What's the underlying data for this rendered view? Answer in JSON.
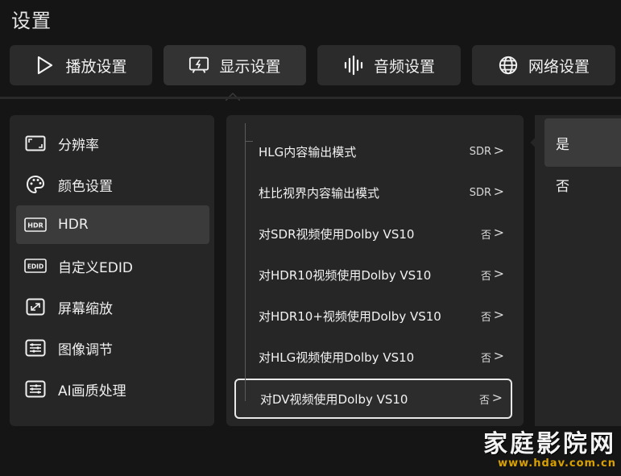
{
  "page": {
    "title": "设置"
  },
  "tabs": [
    {
      "label": "播放设置",
      "icon": "play-icon",
      "active": false
    },
    {
      "label": "显示设置",
      "icon": "display-icon",
      "active": true
    },
    {
      "label": "音频设置",
      "icon": "audio-wave-icon",
      "active": false
    },
    {
      "label": "网络设置",
      "icon": "globe-icon",
      "active": false
    }
  ],
  "sidebar": {
    "items": [
      {
        "label": "分辨率",
        "icon": "resolution-icon"
      },
      {
        "label": "颜色设置",
        "icon": "palette-icon"
      },
      {
        "label": "HDR",
        "icon": "hdr-icon",
        "badge": "HDR",
        "active": true
      },
      {
        "label": "自定义EDID",
        "icon": "edid-icon",
        "badge": "EDID"
      },
      {
        "label": "屏幕缩放",
        "icon": "expand-icon"
      },
      {
        "label": "图像调节",
        "icon": "sliders-icon"
      },
      {
        "label": "AI画质处理",
        "icon": "ai-sliders-icon"
      }
    ]
  },
  "options": {
    "items": [
      {
        "label": "HLG内容输出模式",
        "value": "SDR"
      },
      {
        "label": "杜比视界内容输出模式",
        "value": "SDR"
      },
      {
        "label": "对SDR视频使用Dolby VS10",
        "value": "否"
      },
      {
        "label": "对HDR10视频使用Dolby VS10",
        "value": "否"
      },
      {
        "label": "对HDR10+视频使用Dolby VS10",
        "value": "否"
      },
      {
        "label": "对HLG视频使用Dolby VS10",
        "value": "否"
      },
      {
        "label": "对DV视频使用Dolby VS10",
        "value": "否",
        "focused": true
      }
    ],
    "chevron": ">"
  },
  "choices": {
    "items": [
      {
        "label": "是",
        "active": true
      },
      {
        "label": "否",
        "active": false
      }
    ]
  },
  "watermark": {
    "main": "家庭影院网",
    "url": "www.hdav.com.cn"
  }
}
